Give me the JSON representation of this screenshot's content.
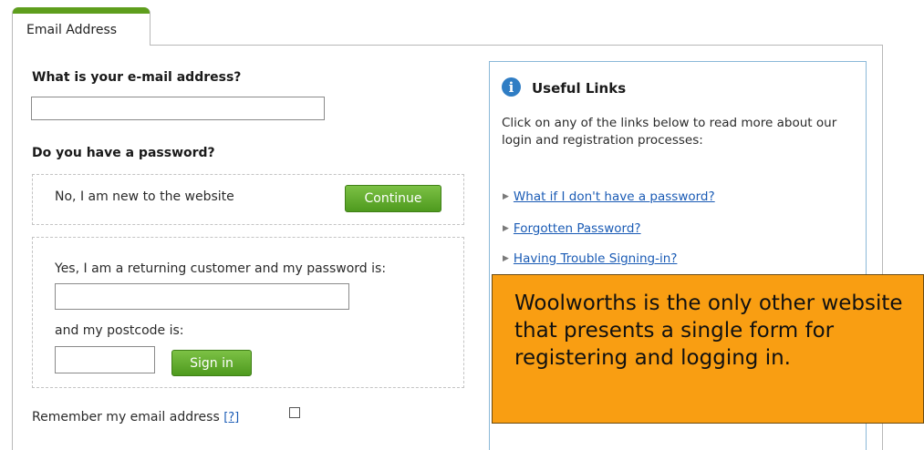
{
  "tab": {
    "label": "Email Address"
  },
  "form": {
    "email_question": "What is your e-mail address?",
    "email_value": "",
    "password_question": "Do you have a password?",
    "new_option": {
      "text": "No, I am new to the website",
      "button_label": "Continue"
    },
    "returning_option": {
      "text": "Yes, I am a returning customer and my password is:",
      "password_value": "",
      "postcode_label": "and my postcode is:",
      "postcode_value": "",
      "button_label": "Sign in"
    },
    "remember": {
      "label": "Remember my email address",
      "help_link": "[?]",
      "checked": false
    }
  },
  "useful_links": {
    "title": "Useful Links",
    "intro": "Click on any of the links below to read more about our login and registration processes:",
    "links": [
      {
        "label": "What if I don't have a password?"
      },
      {
        "label": "Forgotten Password?"
      },
      {
        "label": "Having Trouble Signing-in?"
      }
    ],
    "icon": "info-icon"
  },
  "callout": {
    "text": "Woolworths is the only other website that presents a single form for registering and logging in."
  },
  "colors": {
    "accent_green": "#5e9e1d",
    "button_green": "#5ea82a",
    "link_blue": "#1a5bb5",
    "info_blue": "#2f7dc4",
    "callout_orange": "#f99e12"
  }
}
